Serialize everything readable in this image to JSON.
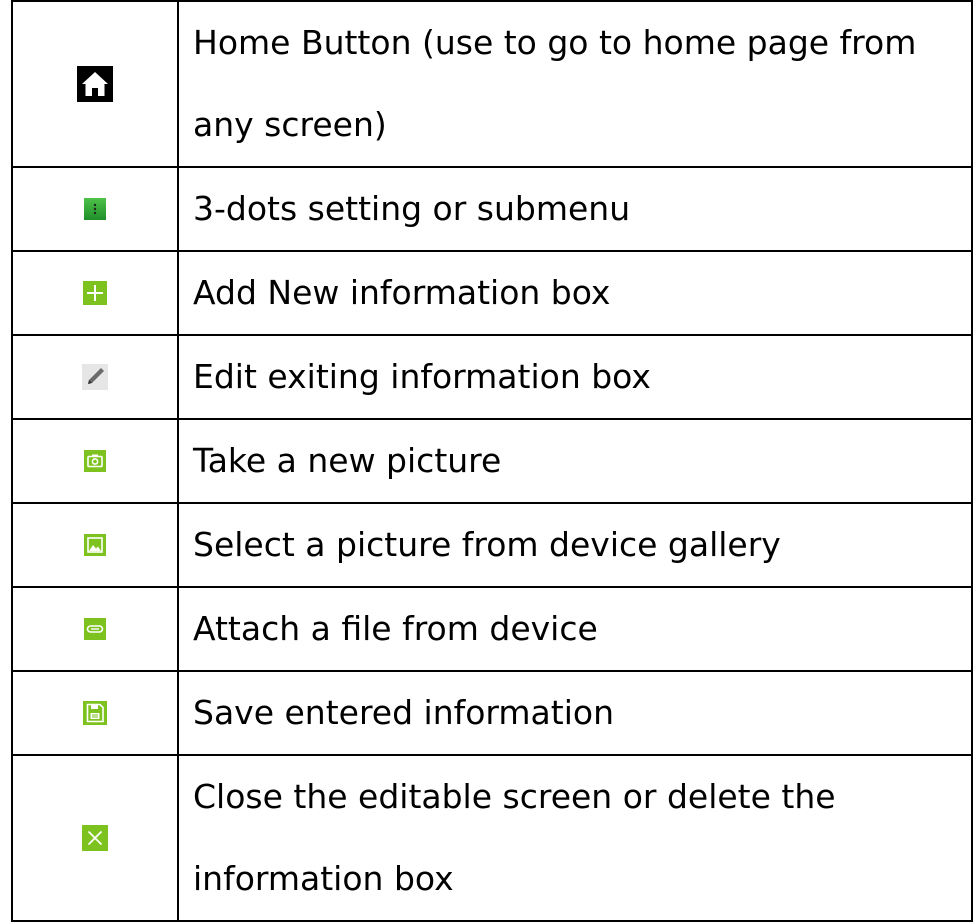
{
  "rows": [
    {
      "icon": "home-icon",
      "text": "Home Button (use to go to home page from any screen)"
    },
    {
      "icon": "more-vert-icon",
      "text": "3-dots setting or submenu"
    },
    {
      "icon": "plus-icon",
      "text": "Add New information box"
    },
    {
      "icon": "pencil-icon",
      "text": "Edit exiting information box"
    },
    {
      "icon": "camera-icon",
      "text": "Take a new picture"
    },
    {
      "icon": "gallery-icon",
      "text": "Select a picture from device gallery"
    },
    {
      "icon": "paperclip-icon",
      "text": "Attach a file from device"
    },
    {
      "icon": "save-icon",
      "text": "Save entered information"
    },
    {
      "icon": "close-icon",
      "text": "Close the editable screen or delete the information box"
    }
  ],
  "colors": {
    "green_icon": "#7dc21e",
    "home_icon_bg": "#000000",
    "pencil_icon_bg": "#e6e6e6",
    "border": "#000000"
  }
}
